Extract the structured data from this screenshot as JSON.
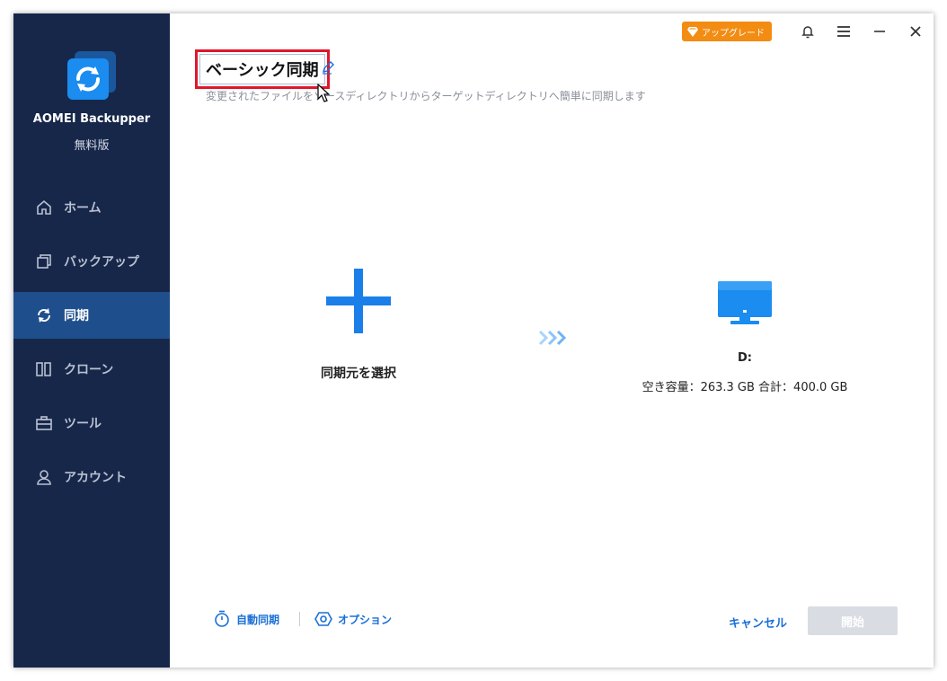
{
  "app": {
    "name": "AOMEI Backupper",
    "edition": "無料版"
  },
  "sidebar": {
    "items": [
      {
        "label": "ホーム",
        "icon": "home-icon"
      },
      {
        "label": "バックアップ",
        "icon": "backup-icon"
      },
      {
        "label": "同期",
        "icon": "sync-icon",
        "active": true
      },
      {
        "label": "クローン",
        "icon": "clone-icon"
      },
      {
        "label": "ツール",
        "icon": "tools-icon"
      },
      {
        "label": "アカウント",
        "icon": "account-icon"
      }
    ]
  },
  "topbar": {
    "upgrade_label": "アップグレード"
  },
  "header": {
    "task_name": "ベーシック同期",
    "subtitle": "変更されたファイルをソースディレクトリからターゲットディレクトリへ簡単に同期します"
  },
  "source": {
    "label": "同期元を選択"
  },
  "destination": {
    "drive": "D:",
    "space": "空き容量：263.3 GB 合計：400.0 GB"
  },
  "footer": {
    "schedule_label": "自動同期",
    "options_label": "オプション",
    "cancel_label": "キャンセル",
    "start_label": "開始"
  },
  "colors": {
    "sidebar_bg": "#17274a",
    "sidebar_active": "#1e4f8c",
    "accent": "#1a6fd6",
    "upgrade": "#f38c13",
    "highlight_border": "#e0162b"
  }
}
